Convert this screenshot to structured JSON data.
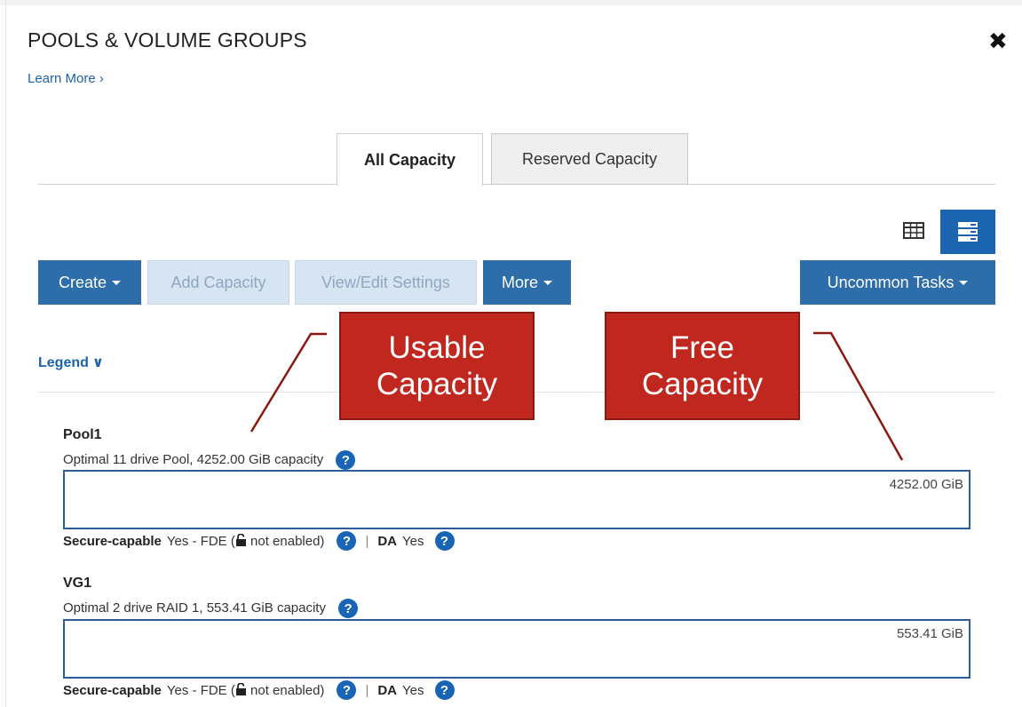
{
  "dialog": {
    "title": "POOLS & VOLUME GROUPS",
    "close_glyph": "✖",
    "learn_more": "Learn More ›"
  },
  "tabs": [
    {
      "label": "All Capacity",
      "active": true
    },
    {
      "label": "Reserved Capacity",
      "active": false
    }
  ],
  "view_toggle": {
    "table_icon": "table-view-icon",
    "list_icon": "list-view-icon",
    "active": "list"
  },
  "toolbar": {
    "create": "Create",
    "add_capacity": "Add Capacity",
    "view_edit": "View/Edit Settings",
    "more": "More",
    "uncommon": "Uncommon Tasks"
  },
  "legend": {
    "label": "Legend",
    "chevron": "∨"
  },
  "callouts": {
    "usable": "Usable Capacity",
    "free": "Free Capacity"
  },
  "groups": [
    {
      "name": "Pool1",
      "description": "Optimal 11 drive Pool, 4252.00 GiB capacity",
      "capacity_label": "4252.00 GiB",
      "secure_label": "Secure-capable",
      "secure_value_a": "Yes - FDE (",
      "secure_value_b": " not enabled)",
      "da_label": "DA",
      "da_value": "Yes"
    },
    {
      "name": "VG1",
      "description": "Optimal 2 drive RAID 1, 553.41 GiB capacity",
      "capacity_label": "553.41 GiB",
      "secure_label": "Secure-capable",
      "secure_value_a": "Yes - FDE (",
      "secure_value_b": " not enabled)",
      "da_label": "DA",
      "da_value": "Yes"
    }
  ],
  "colors": {
    "primary_button": "#2d6eaa",
    "disabled_button": "#d7e4f1",
    "callout_red": "#c0271f",
    "help_blue": "#1865b7"
  }
}
